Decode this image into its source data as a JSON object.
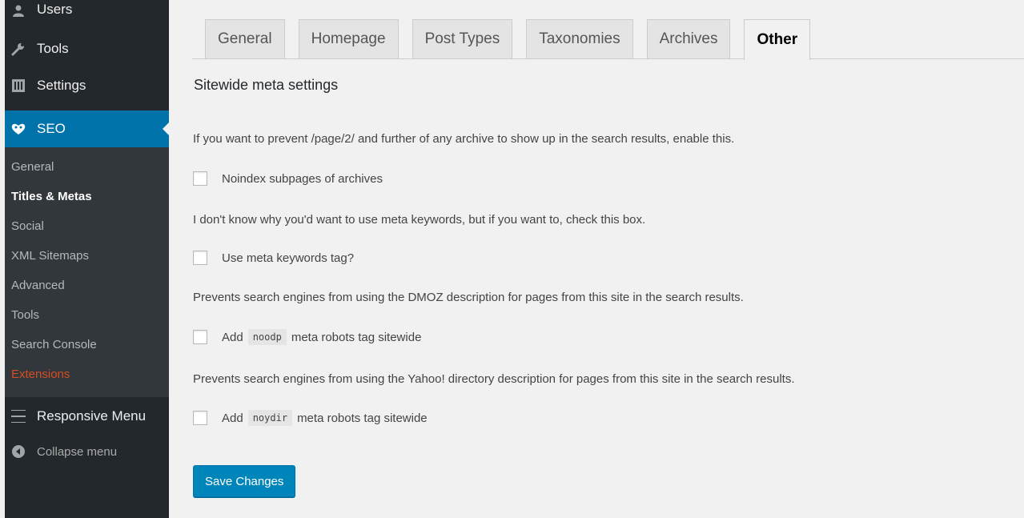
{
  "sidebar": {
    "users": "Users",
    "tools": "Tools",
    "settings": "Settings",
    "seo": "SEO",
    "submenu": [
      "General",
      "Titles & Metas",
      "Social",
      "XML Sitemaps",
      "Advanced",
      "Tools",
      "Search Console",
      "Extensions"
    ],
    "responsive_menu": "Responsive Menu",
    "collapse": "Collapse menu"
  },
  "tabs": [
    "General",
    "Homepage",
    "Post Types",
    "Taxonomies",
    "Archives",
    "Other"
  ],
  "active_tab": "Other",
  "section_title": "Sitewide meta settings",
  "options": [
    {
      "desc": "If you want to prevent /page/2/ and further of any archive to show up in the search results, enable this.",
      "label": "Noindex subpages of archives",
      "checked": false
    },
    {
      "desc": "I don't know why you'd want to use meta keywords, but if you want to, check this box.",
      "label": "Use meta keywords tag?",
      "checked": false
    },
    {
      "desc": "Prevents search engines from using the DMOZ description for pages from this site in the search results.",
      "label_pre": "Add",
      "code": "noodp",
      "label_post": "meta robots tag sitewide",
      "checked": false
    },
    {
      "desc": "Prevents search engines from using the Yahoo! directory description for pages from this site in the search results.",
      "label_pre": "Add",
      "code": "noydir",
      "label_post": "meta robots tag sitewide",
      "checked": false
    }
  ],
  "save_label": "Save Changes",
  "colors": {
    "sidebar_bg": "#23282d",
    "seo_active": "#0073aa",
    "save_button": "#0085ba",
    "extensions": "#d54e21"
  }
}
